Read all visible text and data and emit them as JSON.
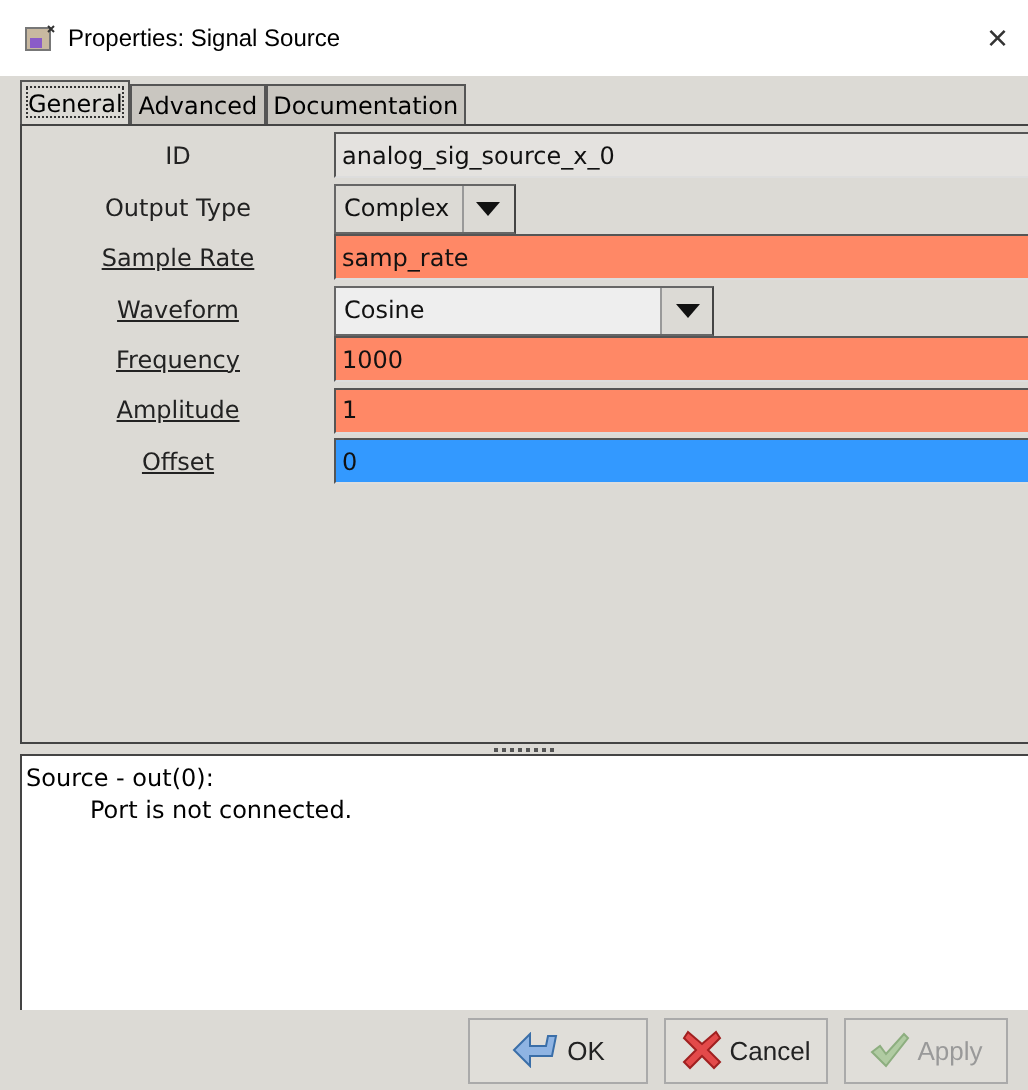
{
  "window": {
    "title": "Properties: Signal Source",
    "close": "×"
  },
  "tabs": [
    {
      "label": "General",
      "selected": true
    },
    {
      "label": "Advanced",
      "selected": false
    },
    {
      "label": "Documentation",
      "selected": false
    }
  ],
  "params": [
    {
      "label": "ID",
      "underlined": false,
      "kind": "entry",
      "value": "analog_sig_source_x_0",
      "color": "#e4e2df"
    },
    {
      "label": "Output Type",
      "underlined": false,
      "kind": "dropdown",
      "value": "Complex",
      "color": "#dcdad5"
    },
    {
      "label": "Sample Rate",
      "underlined": true,
      "kind": "entry",
      "value": "samp_rate",
      "color": "#ff8866"
    },
    {
      "label": "Waveform",
      "underlined": true,
      "kind": "dropdown",
      "value": "Cosine",
      "color": "#eeeeee"
    },
    {
      "label": "Frequency",
      "underlined": true,
      "kind": "entry",
      "value": "1000",
      "color": "#ff8866"
    },
    {
      "label": "Amplitude",
      "underlined": true,
      "kind": "entry",
      "value": "1",
      "color": "#ff8866"
    },
    {
      "label": "Offset",
      "underlined": true,
      "kind": "entry",
      "value": "0",
      "color": "#3399ff"
    }
  ],
  "messages": {
    "heading": "Source - out(0):",
    "lines": [
      "Port is not connected."
    ]
  },
  "buttons": [
    {
      "kind": "ok",
      "label": "OK",
      "disabled": false
    },
    {
      "kind": "cancel",
      "label": "Cancel",
      "disabled": false
    },
    {
      "kind": "apply",
      "label": "Apply",
      "disabled": true
    }
  ]
}
